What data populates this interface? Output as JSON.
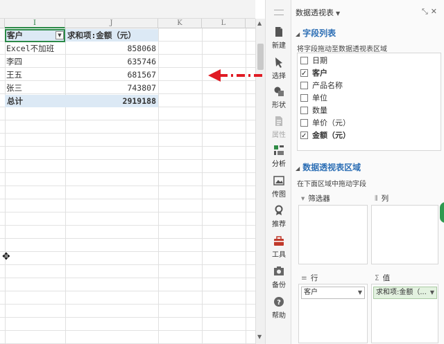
{
  "sheet": {
    "columns": [
      "I",
      "J",
      "K",
      "L"
    ],
    "header": {
      "col1": "客户",
      "col2": "求和项:金额（元）"
    },
    "rows": [
      {
        "name": "Excel不加班",
        "value": "858068"
      },
      {
        "name": "李四",
        "value": "635746"
      },
      {
        "name": "王五",
        "value": "681567"
      },
      {
        "name": "张三",
        "value": "743807"
      }
    ],
    "total": {
      "label": "总计",
      "value": "2919188"
    }
  },
  "toolbar": {
    "items": [
      {
        "label": "新建",
        "icon": "new-doc-icon"
      },
      {
        "label": "选择",
        "icon": "select-cursor-icon"
      },
      {
        "label": "形状",
        "icon": "shapes-icon"
      },
      {
        "label": "属性",
        "icon": "properties-icon"
      },
      {
        "label": "分析",
        "icon": "analysis-icon"
      },
      {
        "label": "传图",
        "icon": "image-upload-icon"
      },
      {
        "label": "推荐",
        "icon": "recommend-icon"
      },
      {
        "label": "工具",
        "icon": "toolbox-icon"
      },
      {
        "label": "备份",
        "icon": "backup-icon"
      },
      {
        "label": "帮助",
        "icon": "help-icon"
      }
    ]
  },
  "pane": {
    "title": "数据透视表",
    "field_section": "字段列表",
    "field_hint": "将字段拖动至数据透视表区域",
    "fields": [
      {
        "label": "日期",
        "checked": false
      },
      {
        "label": "客户",
        "checked": true
      },
      {
        "label": "产品名称",
        "checked": false
      },
      {
        "label": "单位",
        "checked": false
      },
      {
        "label": "数量",
        "checked": false
      },
      {
        "label": "单价（元）",
        "checked": false
      },
      {
        "label": "金额（元）",
        "checked": true
      }
    ],
    "area_section": "数据透视表区域",
    "area_hint": "在下面区域中拖动字段",
    "zones": {
      "filter": "筛选器",
      "columns": "列",
      "rows": "行",
      "values": "值"
    },
    "row_chip": "客户",
    "value_chip": "求和项:金额（..."
  },
  "colors": {
    "accent": "#2d6fb5",
    "select_green": "#2c8a48",
    "pivot_header_bg": "#dce9f5",
    "arrow_red": "#e01b24"
  }
}
